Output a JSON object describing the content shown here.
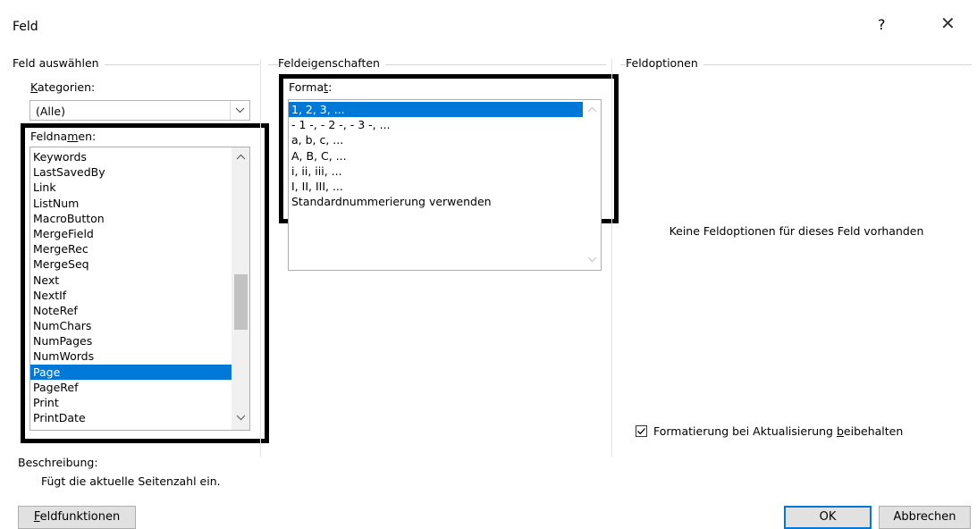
{
  "dialog": {
    "title": "Feld",
    "help_label": "?",
    "close_glyph": "✕"
  },
  "field_select": {
    "group_title": "Feld auswählen",
    "categories_label_pre": "",
    "categories_label_ul": "K",
    "categories_label_post": "ategorien:",
    "categories_value": "(Alle)",
    "names_label_pre": "Feldna",
    "names_label_ul": "m",
    "names_label_post": "en:",
    "names": [
      "Keywords",
      "LastSavedBy",
      "Link",
      "ListNum",
      "MacroButton",
      "MergeField",
      "MergeRec",
      "MergeSeq",
      "Next",
      "NextIf",
      "NoteRef",
      "NumChars",
      "NumPages",
      "NumWords",
      "Page",
      "PageRef",
      "Print",
      "PrintDate"
    ],
    "selected": "Page"
  },
  "field_properties": {
    "group_title": "Feldeigenschaften",
    "format_label_pre": "Forma",
    "format_label_ul": "t",
    "format_label_post": ":",
    "formats": [
      "1, 2, 3, ...",
      "- 1 -, - 2 -, - 3 -, ...",
      "a, b, c, ...",
      "A, B, C, ...",
      "i, ii, iii, ...",
      "I, II, III, ...",
      "Standardnummerierung verwenden"
    ],
    "selected": "1, 2, 3, ..."
  },
  "field_options": {
    "group_title": "Feldoptionen",
    "empty_message": "Keine Feldoptionen für dieses Feld vorhanden",
    "preserve_pre": "Formatierung bei Aktualisierung ",
    "preserve_ul": "b",
    "preserve_post": "eibehalten",
    "preserve_checked": true
  },
  "description": {
    "label": "Beschreibung:",
    "text": "Fügt die aktuelle Seitenzahl ein."
  },
  "buttons": {
    "codes_ul": "F",
    "codes_rest": "eldfunktionen",
    "ok": "OK",
    "cancel": "Abbrechen"
  },
  "colors": {
    "selection": "#0078d7",
    "highlight_border": "#000000"
  }
}
